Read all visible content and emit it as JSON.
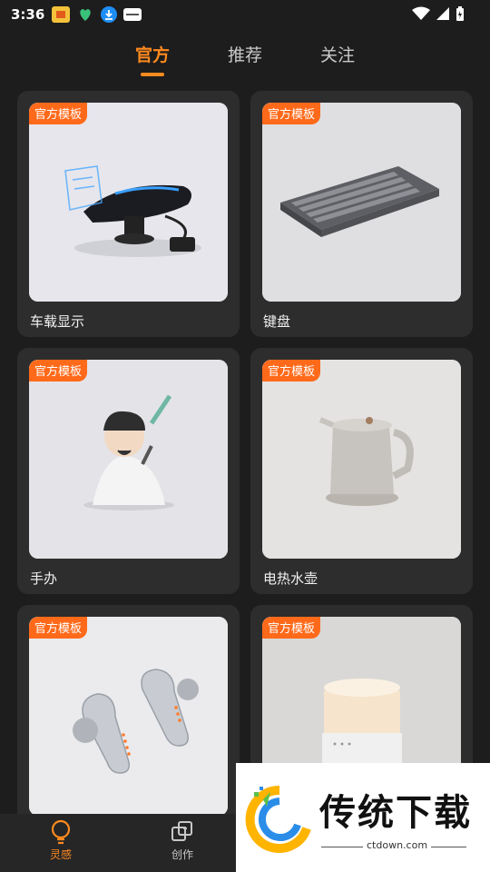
{
  "status_bar": {
    "time": "3:36"
  },
  "tabs": [
    {
      "label": "官方",
      "active": true
    },
    {
      "label": "推荐",
      "active": false
    },
    {
      "label": "关注",
      "active": false
    }
  ],
  "cards": [
    {
      "badge": "官方模板",
      "title": "车载显示",
      "image": "car-display-image"
    },
    {
      "badge": "官方模板",
      "title": "键盘",
      "image": "keyboard-image"
    },
    {
      "badge": "官方模板",
      "title": "手办",
      "image": "figurine-image"
    },
    {
      "badge": "官方模板",
      "title": "电热水壶",
      "image": "kettle-image"
    },
    {
      "badge": "官方模板",
      "title": "",
      "image": "earbuds-image"
    },
    {
      "badge": "官方模板",
      "title": "",
      "image": "humidifier-image"
    }
  ],
  "bottom_nav": [
    {
      "label": "灵感",
      "icon": "lightbulb-icon",
      "active": true
    },
    {
      "label": "创作",
      "icon": "create-icon",
      "active": false
    }
  ],
  "watermark": {
    "title": "传统下载",
    "url": "ctdown.com"
  },
  "colors": {
    "accent": "#ff8a1f",
    "badge": "#ff6a1a",
    "background": "#1d1d1d",
    "card": "#2d2d2d"
  }
}
